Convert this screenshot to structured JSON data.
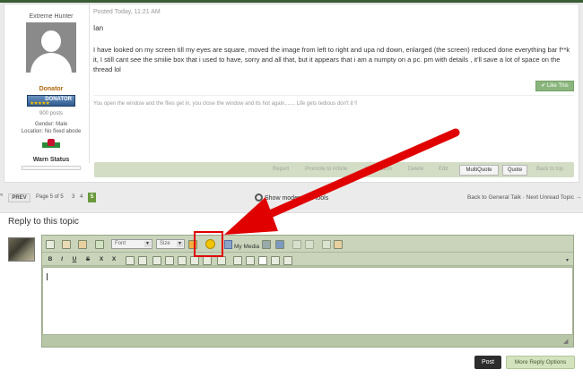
{
  "post": {
    "author": {
      "name": "Extreme Hunter",
      "group": "Donator",
      "rank_badge": "DONATOR",
      "posts": "900 posts",
      "gender": "Gender: Male",
      "location": "Location: No fixed abode",
      "warn_status": "Warn Status"
    },
    "posted": "Posted Today, 11:21 AM",
    "greeting": "Ian",
    "body": "I have looked on my screen till my eyes are square, moved the image from left to right and upa nd down, enlarged (the screen) reduced done everything bar f**k it, I still cant see the smilie box that i used to have, sorry and all that, but it appears that i am a numpty on a pc. pm with details , it'll save a lot of space on the thread lol",
    "like_label": "Like This",
    "signature": "You open the window and the flies get in, you close the window and its hot again....... Life gets tedious don't it !!",
    "actions": {
      "report": "Report",
      "promote": "Promote to Article",
      "moderation": "Moderation",
      "delete": "Delete",
      "edit": "Edit",
      "multiquote": "MultiQuote",
      "quote": "Quote",
      "back_to_top": "Back to top"
    }
  },
  "pager": {
    "prev": "PREV",
    "page_label": "Page 5 of 5",
    "pages": [
      "3",
      "4"
    ],
    "current": "5",
    "mod_tools": "Show moderation tools",
    "next_nav": "Back to General Talk · Next Unread Topic →"
  },
  "reply": {
    "title": "Reply to this topic",
    "font_label": "Font",
    "size_label": "Size",
    "my_media": "My Media",
    "format_buttons": [
      "B",
      "I",
      "U",
      "S",
      "X",
      "X"
    ],
    "post_label": "Post",
    "more_options": "More Reply Options"
  },
  "colors": {
    "accent_green": "#6a9a3a",
    "annotation_red": "#e00000",
    "editor_bg": "#c9d4bb"
  }
}
